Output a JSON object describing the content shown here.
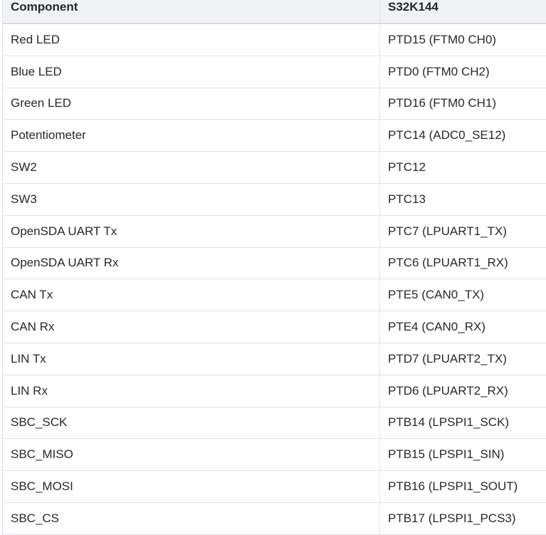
{
  "table": {
    "headers": [
      "Component",
      "S32K144"
    ],
    "rows": [
      [
        "Red LED",
        "PTD15 (FTM0 CH0)"
      ],
      [
        "Blue LED",
        "PTD0 (FTM0 CH2)"
      ],
      [
        "Green LED",
        "PTD16 (FTM0 CH1)"
      ],
      [
        "Potentiometer",
        "PTC14 (ADC0_SE12)"
      ],
      [
        "SW2",
        "PTC12"
      ],
      [
        "SW3",
        "PTC13"
      ],
      [
        "OpenSDA UART Tx",
        "PTC7 (LPUART1_TX)"
      ],
      [
        "OpenSDA UART Rx",
        "PTC6 (LPUART1_RX)"
      ],
      [
        "CAN Tx",
        "PTE5 (CAN0_TX)"
      ],
      [
        "CAN Rx",
        "PTE4 (CAN0_RX)"
      ],
      [
        "LIN Tx",
        "PTD7 (LPUART2_TX)"
      ],
      [
        "LIN Rx",
        "PTD6 (LPUART2_RX)"
      ],
      [
        "SBC_SCK",
        "PTB14 (LPSPI1_SCK)"
      ],
      [
        "SBC_MISO",
        "PTB15 (LPSPI1_SIN)"
      ],
      [
        "SBC_MOSI",
        "PTB16 (LPSPI1_SOUT)"
      ],
      [
        "SBC_CS",
        "PTB17 (LPSPI1_PCS3)"
      ]
    ]
  }
}
